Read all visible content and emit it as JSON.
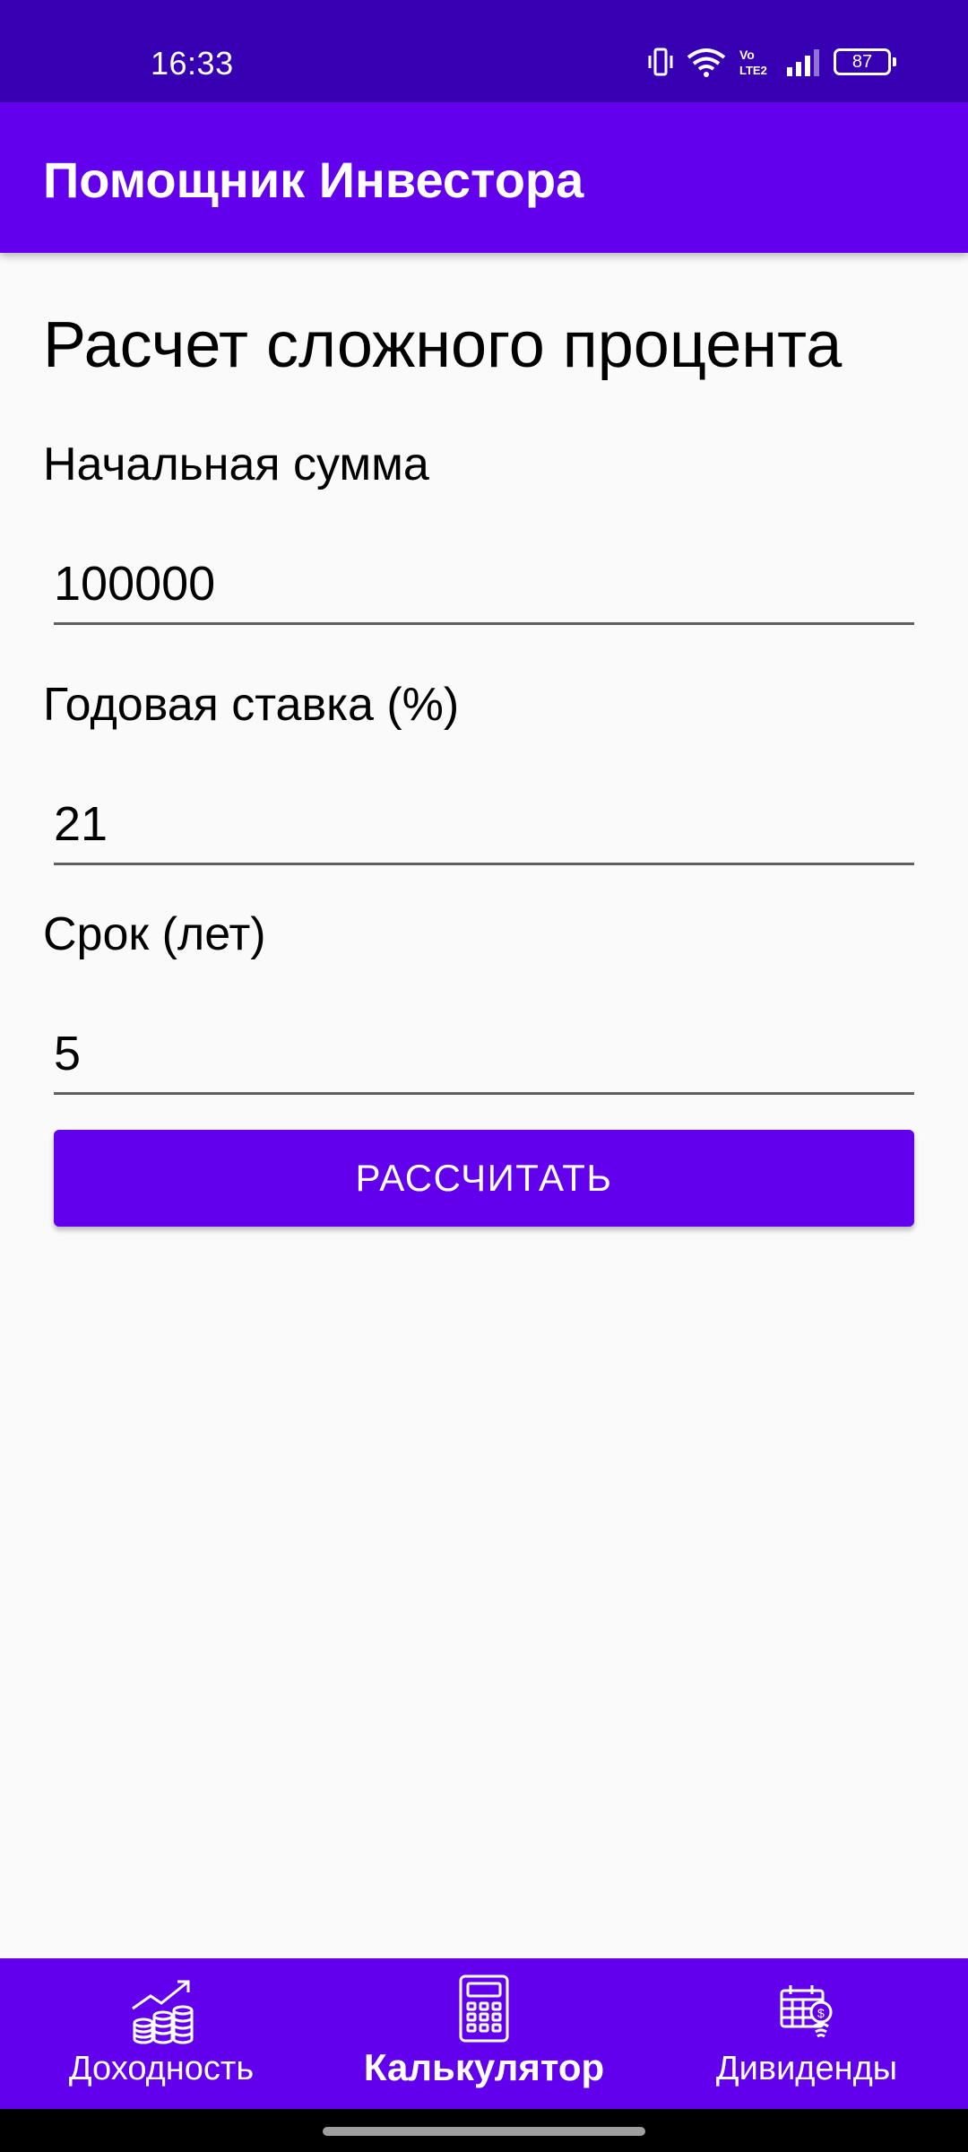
{
  "status_bar": {
    "time": "16:33",
    "network_label": "Vo LTE2",
    "battery": "87",
    "icons": [
      "vibrate-icon",
      "wifi-icon",
      "volte-icon",
      "signal-icon",
      "battery-icon"
    ]
  },
  "app_bar": {
    "title": "Помощник Инвестора"
  },
  "form": {
    "title": "Расчет сложного процента",
    "fields": [
      {
        "label": "Начальная сумма",
        "value": "100000"
      },
      {
        "label": "Годовая ставка (%)",
        "value": "21"
      },
      {
        "label": "Срок (лет)",
        "value": "5"
      }
    ],
    "submit_label": "РАССЧИТАТЬ"
  },
  "bottom_nav": {
    "items": [
      {
        "label": "Доходность",
        "icon": "growth-coins-icon",
        "active": false
      },
      {
        "label": "Калькулятор",
        "icon": "calculator-icon",
        "active": true
      },
      {
        "label": "Дивиденды",
        "icon": "dividend-calendar-icon",
        "active": false
      }
    ]
  },
  "colors": {
    "status_bar": "#3700b3",
    "primary": "#6200ee",
    "background": "#fafafa",
    "text": "#000000",
    "on_primary": "#ffffff"
  }
}
